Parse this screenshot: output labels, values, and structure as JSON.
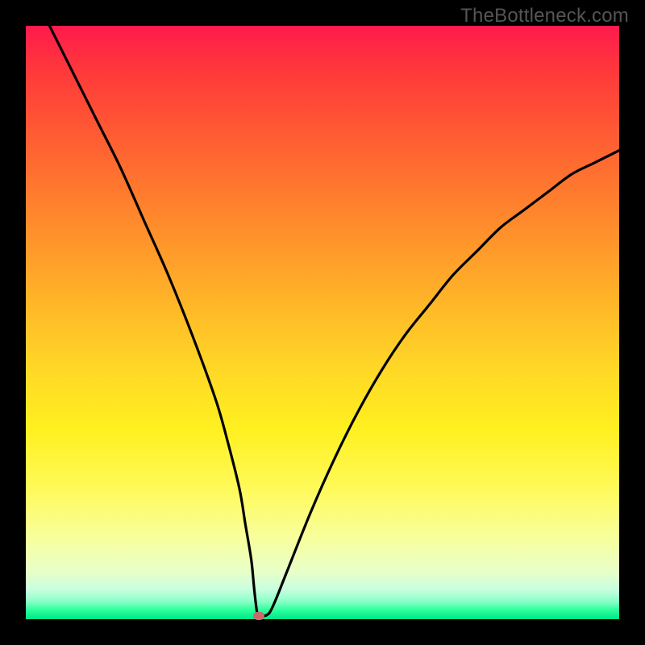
{
  "watermark": "TheBottleneck.com",
  "colors": {
    "frame": "#000000",
    "gradient_top": "#ff1a4d",
    "gradient_bottom": "#00e58a",
    "curve": "#000000",
    "marker": "#c96a6a"
  },
  "chart_data": {
    "type": "line",
    "title": "",
    "xlabel": "",
    "ylabel": "",
    "xlim": [
      0,
      100
    ],
    "ylim": [
      0,
      100
    ],
    "series": [
      {
        "name": "bottleneck-curve",
        "x": [
          4,
          8,
          12,
          16,
          20,
          24,
          28,
          32,
          34,
          36,
          37,
          38,
          38.5,
          39,
          39.5,
          40,
          41,
          42,
          44,
          48,
          52,
          56,
          60,
          64,
          68,
          72,
          76,
          80,
          84,
          88,
          92,
          96,
          100
        ],
        "y": [
          100,
          92,
          84,
          76,
          67,
          58,
          48,
          37,
          30,
          22,
          16,
          10,
          5,
          1,
          0.5,
          0.5,
          1,
          3,
          8,
          18,
          27,
          35,
          42,
          48,
          53,
          58,
          62,
          66,
          69,
          72,
          75,
          77,
          79
        ]
      }
    ],
    "marker": {
      "x": 39.2,
      "y": 0.5
    },
    "grid": false,
    "legend": false
  }
}
